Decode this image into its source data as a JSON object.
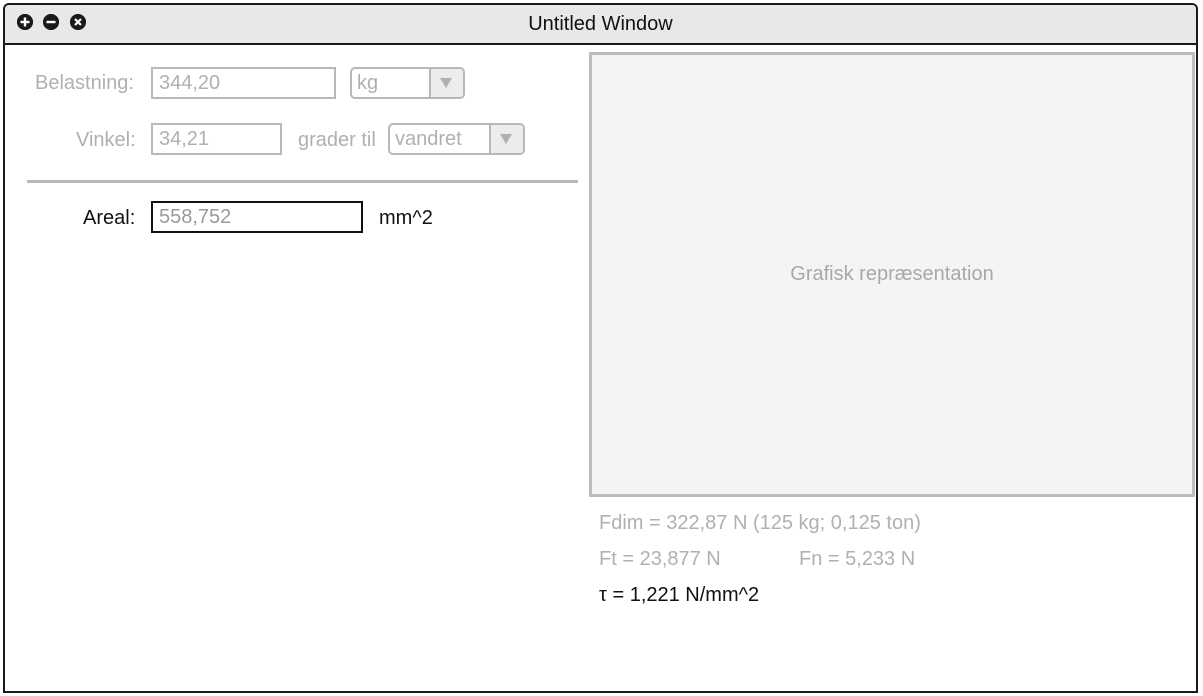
{
  "window": {
    "title": "Untitled Window",
    "buttons": {
      "add": "+",
      "minimize": "−",
      "close": "×"
    }
  },
  "form": {
    "load_label": "Belastning:",
    "load_value": "344,20",
    "load_unit": "kg",
    "angle_label": "Vinkel:",
    "angle_value": "34,21",
    "angle_suffix": "grader til",
    "angle_reference": "vandret",
    "area_label": "Areal:",
    "area_value": "558,752",
    "area_unit": "mm^2"
  },
  "graphic": {
    "placeholder": "Grafisk repræsentation"
  },
  "results": {
    "fdim": "Fdim = 322,87 N (125 kg; 0,125 ton)",
    "ft": "Ft = 23,877 N",
    "fn": "Fn = 5,233 N",
    "tau": "τ = 1,221 N/mm^2"
  },
  "colors": {
    "disabled_text": "#b0b0b0",
    "border": "#1a1a1a",
    "graphic_bg": "#f4f4f4"
  }
}
